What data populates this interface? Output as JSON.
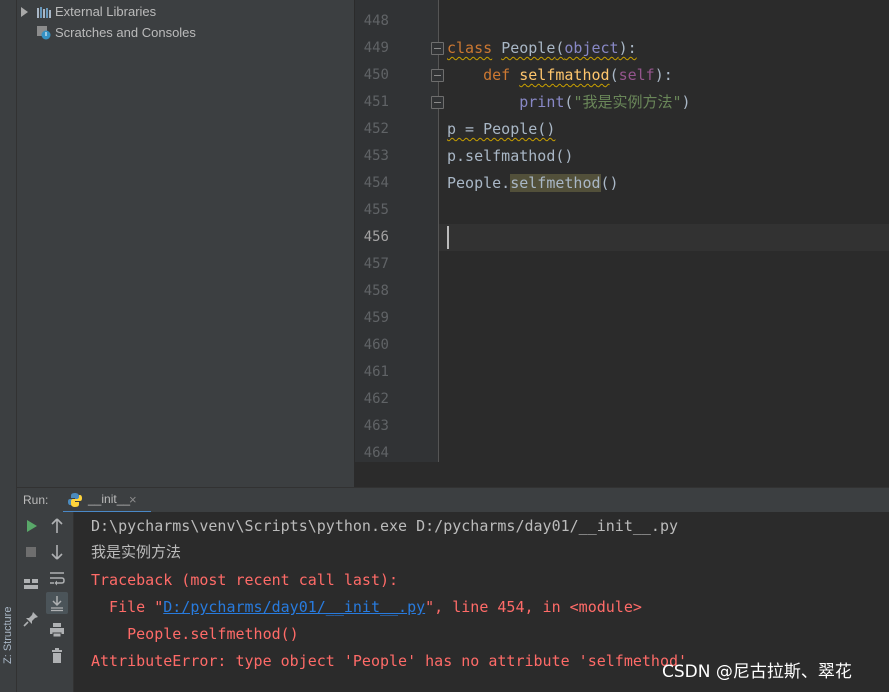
{
  "project_tree": {
    "items": [
      {
        "label": "External Libraries",
        "icon": "library-icon"
      },
      {
        "label": "Scratches and Consoles",
        "icon": "scratches-icon"
      }
    ]
  },
  "side_tab": {
    "structure_label": "Z: Structure"
  },
  "editor": {
    "line_numbers": [
      "448",
      "449",
      "450",
      "451",
      "452",
      "453",
      "454",
      "455",
      "456",
      "457",
      "458",
      "459",
      "460",
      "461",
      "462",
      "463",
      "464"
    ],
    "current_line": "456",
    "code": {
      "l449": {
        "kw": "class",
        "name": "People",
        "open": "(",
        "base": "object",
        "close": "):"
      },
      "l450": {
        "indent": "    ",
        "kw": "def",
        "name": "selfmathod",
        "open": "(",
        "param": "self",
        "close": "):"
      },
      "l451": {
        "indent": "        ",
        "func": "print",
        "open": "(",
        "str": "\"我是实例方法\"",
        "close": ")"
      },
      "l452": {
        "text": "p = People()"
      },
      "l453": {
        "text": "p.selfmathod()"
      },
      "l454": {
        "prefix": "People.",
        "method": "selfmethod",
        "suffix": "()"
      }
    }
  },
  "run_panel": {
    "label": "Run:",
    "tab_label": "__init__",
    "tab_close": "×",
    "console": {
      "command": "D:\\pycharms\\venv\\Scripts\\python.exe D:/pycharms/day01/__init__.py",
      "output": "我是实例方法",
      "traceback_header": "Traceback (most recent call last):",
      "file_prefix": "  File \"",
      "file_link": "D:/pycharms/day01/__init__.py",
      "file_suffix": "\", line 454, in <module>",
      "code_line": "    People.selfmethod()",
      "error": "AttributeError: type object 'People' has no attribute 'selfmethod'"
    }
  },
  "watermark": "CSDN @尼古拉斯、翠花",
  "colors": {
    "keyword": "#cc7832",
    "string": "#6a8759",
    "self_param": "#94558d",
    "function_def": "#ffc66d",
    "builtin": "#8888c6",
    "error_text": "#ff6b68",
    "link": "#287bde",
    "run_green": "#59a869"
  }
}
